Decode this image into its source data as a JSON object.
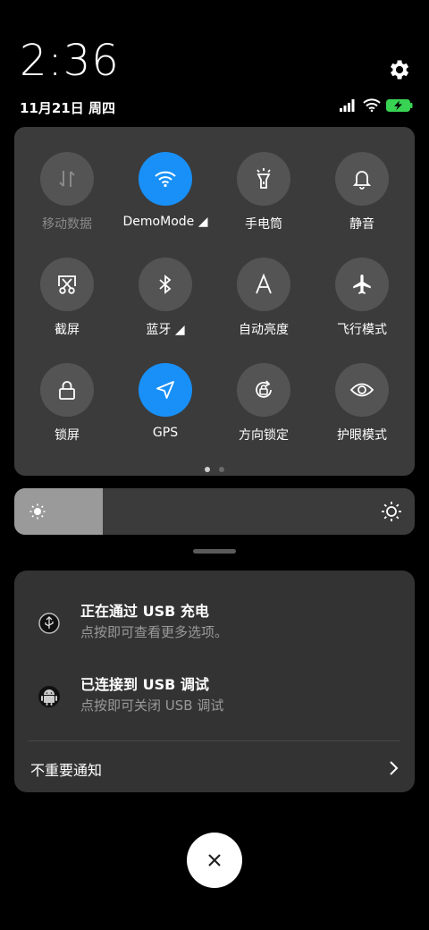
{
  "status": {
    "time": "2:36",
    "date": "11月21日 周四",
    "icons": [
      "settings-gear-icon",
      "signal-icon",
      "wifi-icon",
      "battery-charging-icon"
    ]
  },
  "tiles": [
    {
      "label": "移动数据",
      "icon": "mobile-data-icon",
      "active": false,
      "disabled": true
    },
    {
      "label": "DemoMode ◢",
      "icon": "wifi-icon",
      "active": true
    },
    {
      "label": "手电筒",
      "icon": "flashlight-icon",
      "active": false
    },
    {
      "label": "静音",
      "icon": "bell-icon",
      "active": false
    },
    {
      "label": "截屏",
      "icon": "screenshot-icon",
      "active": false
    },
    {
      "label": "蓝牙 ◢",
      "icon": "bluetooth-icon",
      "active": false
    },
    {
      "label": "自动亮度",
      "icon": "auto-brightness-icon",
      "active": false
    },
    {
      "label": "飞行模式",
      "icon": "airplane-icon",
      "active": false
    },
    {
      "label": "锁屏",
      "icon": "lock-icon",
      "active": false
    },
    {
      "label": "GPS",
      "icon": "location-arrow-icon",
      "active": true
    },
    {
      "label": "方向锁定",
      "icon": "rotation-lock-icon",
      "active": false
    },
    {
      "label": "护眼模式",
      "icon": "eye-icon",
      "active": false
    }
  ],
  "pager": {
    "pages": 2,
    "current": 1
  },
  "brightness": {
    "level_fraction": 0.22
  },
  "notifications": [
    {
      "title": "正在通过 USB 充电",
      "subtitle": "点按即可查看更多选项。",
      "icon": "usb-charge-icon"
    },
    {
      "title": "已连接到 USB 调试",
      "subtitle": "点按即可关闭 USB 调试",
      "icon": "android-icon"
    }
  ],
  "minor_notifications": {
    "label": "不重要通知"
  },
  "colors": {
    "accent": "#1890f8",
    "panel": "#3b3b3b",
    "tile_off": "#545454",
    "battery": "#39d353"
  }
}
